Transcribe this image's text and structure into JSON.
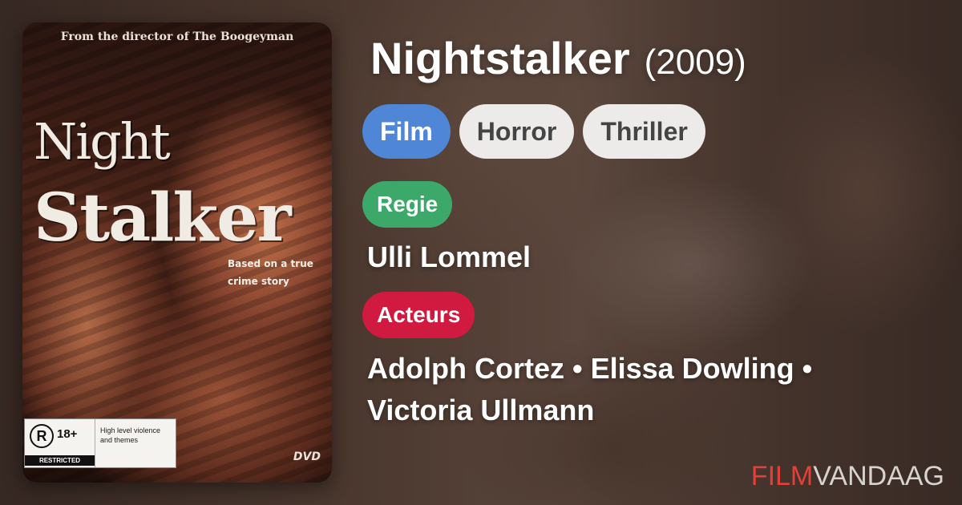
{
  "movie": {
    "title": "Nightstalker",
    "year": "(2009)"
  },
  "poster": {
    "tagline": "From the director of The Boogeyman",
    "title_line1": "Night",
    "title_line2": "Stalker",
    "based_on": "Based on a true crime story",
    "rating": {
      "classification": "R",
      "age": "18+",
      "restricted_label": "RESTRICTED",
      "consumer_advice": "High level violence and themes"
    },
    "format_logo": "DVD"
  },
  "tags": [
    {
      "label": "Film"
    },
    {
      "label": "Horror"
    },
    {
      "label": "Thriller"
    }
  ],
  "director": {
    "badge": "Regie",
    "name": "Ulli Lommel"
  },
  "cast": {
    "badge": "Acteurs",
    "line1": "Adolph Cortez • Elissa Dowling •",
    "line2": "Victoria Ullmann"
  },
  "brand": {
    "part1": "FILM",
    "part2": "VANDAAG"
  },
  "colors": {
    "tag_primary": "#4f86d6",
    "tag_light": "#ecebe9",
    "badge_regie": "#3ca86a",
    "badge_acteurs": "#d11a3f",
    "brand_red": "#e2403a"
  }
}
